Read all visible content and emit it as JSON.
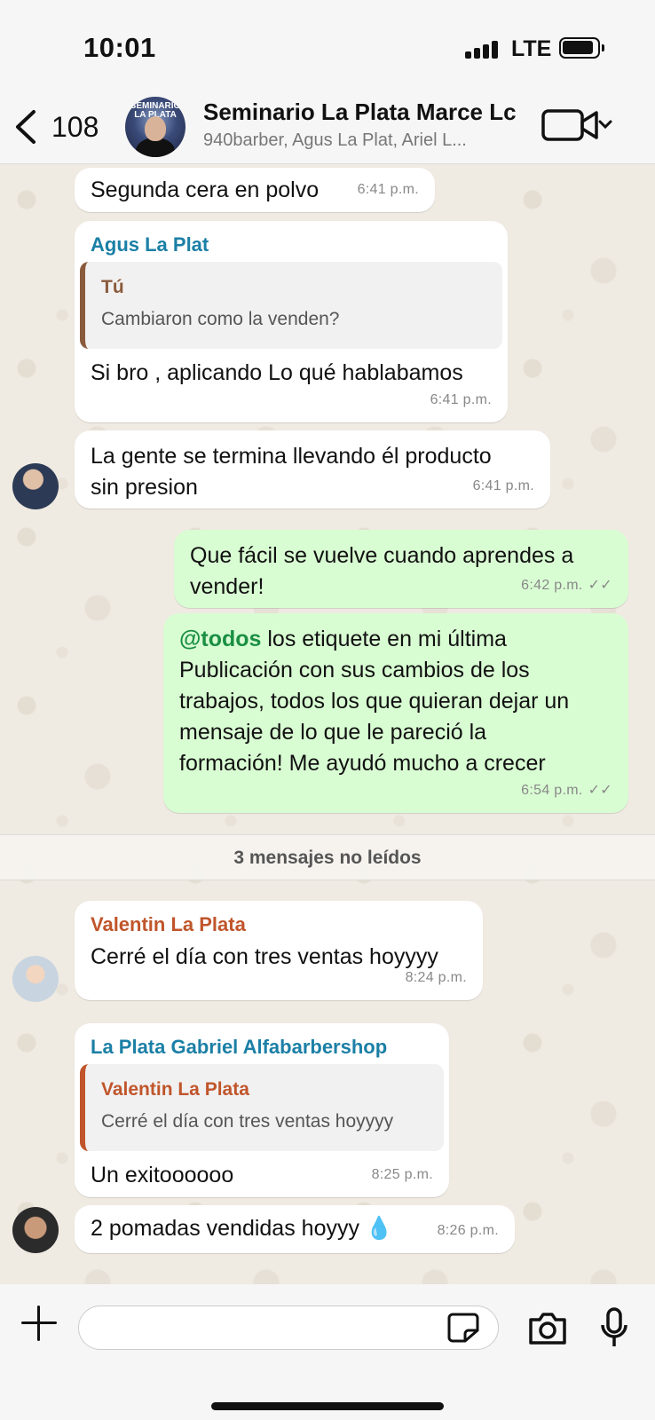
{
  "status_bar": {
    "time": "10:01",
    "network": "LTE"
  },
  "header": {
    "back_count": "108",
    "title": "Seminario La Plata Marce Lc",
    "subtitle": "940barber, Agus La Plat, Ariel L...",
    "avatar_text": "SEMINARIO LA PLATA"
  },
  "messages": [
    {
      "text": "Segunda cera en polvo",
      "time": "6:41 p.m."
    },
    {
      "sender": "Agus La Plat",
      "quote_name": "Tú",
      "quote_text": "Cambiaron como la venden?",
      "text": "Si bro , aplicando Lo qué hablabamos",
      "time": "6:41 p.m."
    },
    {
      "text_line1": "La gente se termina llevando él producto",
      "text_line2": "sin presion",
      "time": "6:41 p.m."
    },
    {
      "text_line1": "Que fácil se vuelve cuando aprendes a",
      "text_line2": "vender!",
      "time": "6:42 p.m."
    },
    {
      "mention": "@todos",
      "line1": " los etiquete en mi última",
      "line2": "Publicación con sus cambios de los",
      "line3": "trabajos, todos los que quieran dejar un",
      "line4": "mensaje de lo que le pareció la",
      "line5": "formación! Me ayudó mucho a crecer",
      "time": "6:54 p.m."
    },
    {
      "sender": "Valentin La Plata",
      "text": "Cerré el día con tres ventas hoyyyy",
      "time": "8:24 p.m."
    },
    {
      "sender": "La Plata  Gabriel Alfabarbershop",
      "quote_name": "Valentin La Plata",
      "quote_text": "Cerré el día con tres ventas hoyyyy",
      "text": "Un exitoooooo",
      "time": "8:25 p.m."
    },
    {
      "text": "2 pomadas vendidas hoyyy",
      "emoji": "💧",
      "time": "8:26 p.m."
    }
  ],
  "unread_banner": "3 mensajes no leídos",
  "input": {
    "placeholder": ""
  },
  "colors": {
    "outgoing": "#d9fdd3",
    "incoming": "#ffffff",
    "background": "#efeae2",
    "mention": "#1a8f43"
  }
}
